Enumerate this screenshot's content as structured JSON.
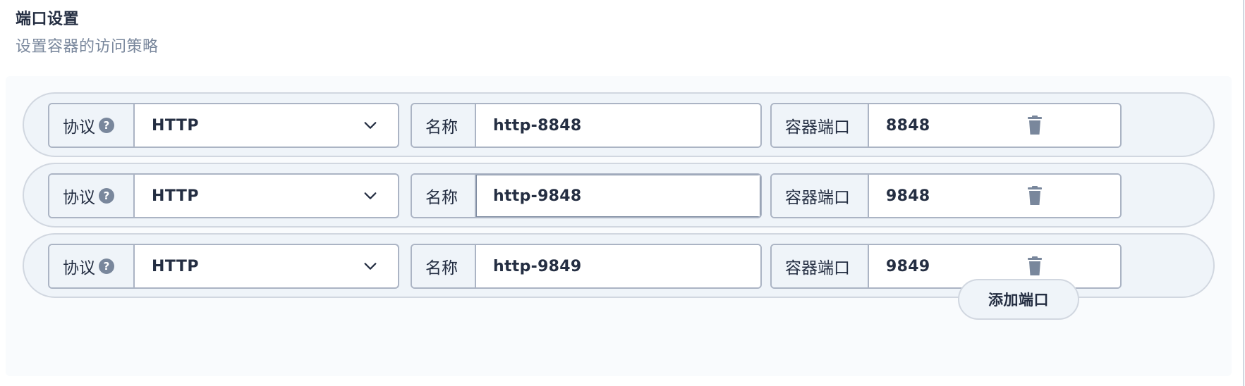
{
  "header": {
    "title": "端口设置",
    "description": "设置容器的访问策略"
  },
  "ports": [
    {
      "protocol_label": "协议",
      "help": "?",
      "protocol": "HTTP",
      "name_label": "名称",
      "name": "http-8848",
      "port_label": "容器端口",
      "port": "8848"
    },
    {
      "protocol_label": "协议",
      "help": "?",
      "protocol": "HTTP",
      "name_label": "名称",
      "name": "http-9848",
      "port_label": "容器端口",
      "port": "9848"
    },
    {
      "protocol_label": "协议",
      "help": "?",
      "protocol": "HTTP",
      "name_label": "名称",
      "name": "http-9849",
      "port_label": "容器端口",
      "port": "9849"
    }
  ],
  "add_button": {
    "label": "添加端口"
  },
  "icons": {
    "help": "question-circle-icon",
    "select": "chevron-down-icon",
    "delete": "trash-icon"
  },
  "colors": {
    "text": "#242e42",
    "muted": "#79879c",
    "border": "#abb4c4",
    "row_bg": "#eff4f9"
  }
}
